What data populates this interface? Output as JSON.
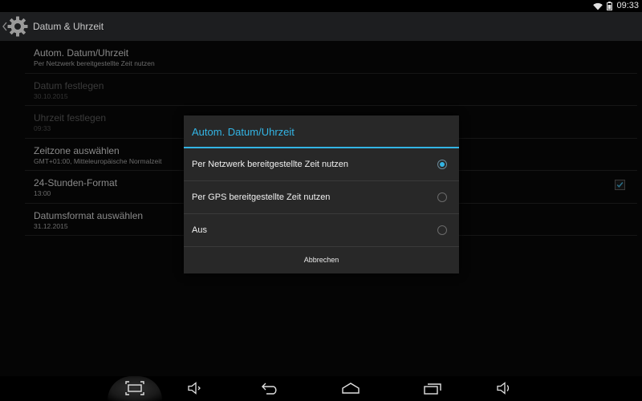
{
  "status_bar": {
    "time": "09:33"
  },
  "action_bar": {
    "title": "Datum & Uhrzeit"
  },
  "preferences": [
    {
      "title": "Autom. Datum/Uhrzeit",
      "summary": "Per Netzwerk bereitgestellte Zeit nutzen",
      "enabled": true
    },
    {
      "title": "Datum festlegen",
      "summary": "30.10.2015",
      "enabled": false
    },
    {
      "title": "Uhrzeit festlegen",
      "summary": "09:33",
      "enabled": false
    },
    {
      "title": "Zeitzone auswählen",
      "summary": "GMT+01:00, Mitteleuropäische Normalzeit",
      "enabled": true
    },
    {
      "title": "24-Stunden-Format",
      "summary": "13:00",
      "enabled": true,
      "checked": true
    },
    {
      "title": "Datumsformat auswählen",
      "summary": "31.12.2015",
      "enabled": true
    }
  ],
  "dialog": {
    "title": "Autom. Datum/Uhrzeit",
    "options": [
      {
        "label": "Per Netzwerk bereitgestellte Zeit nutzen",
        "selected": true
      },
      {
        "label": "Per GPS bereitgestellte Zeit nutzen",
        "selected": false
      },
      {
        "label": "Aus",
        "selected": false
      }
    ],
    "cancel_label": "Abbrechen"
  },
  "nav_bar": {
    "icons": [
      "screenshot-icon",
      "volume-down-icon",
      "back-icon",
      "home-icon",
      "recent-apps-icon",
      "volume-up-icon"
    ]
  },
  "colors": {
    "accent": "#33b5e5",
    "dialog_bg": "#282828",
    "action_bar_bg": "#1d1e20"
  }
}
